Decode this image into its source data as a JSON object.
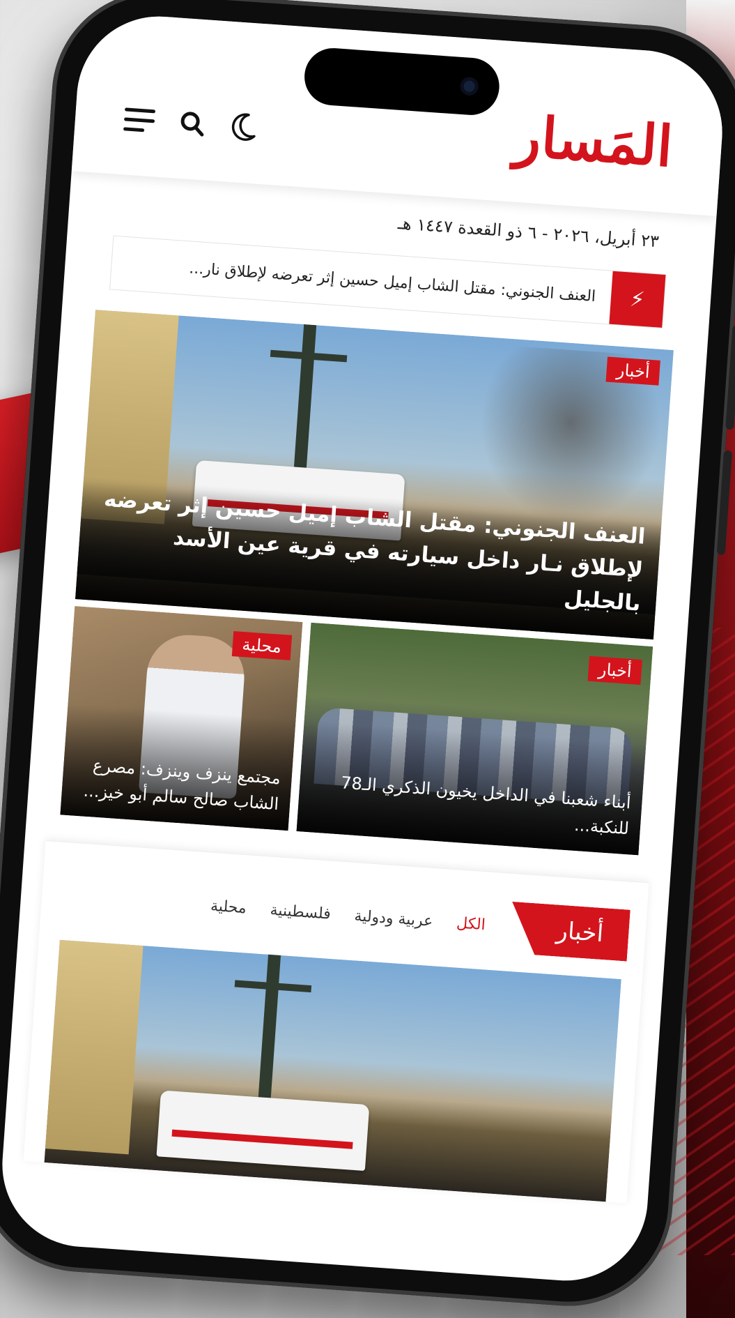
{
  "app": {
    "logo_text": "المَسار",
    "brand_color": "#d3141c",
    "date_text": "٢٣ أبريل، ٢٠٢٦ - ٦ ذو القعدة ١٤٤٧ هـ"
  },
  "header": {
    "icons": [
      "hamburger-menu-icon",
      "search-icon",
      "moon-icon"
    ]
  },
  "ticker": {
    "icon": "bolt-icon",
    "text": "العنف الجنوني: مقتل الشاب إميل حسين إثر تعرضه لإطلاق نار..."
  },
  "hero": {
    "badge": "أخبار",
    "title": "العنف الجنوني: مقتل الشاب إميل حسين إثر تعرضه لإطلاق نـار داخل سيارته في قرية عين الأسد بالجليل"
  },
  "cards": [
    {
      "badge": "أخبار",
      "title": "أبناء شعبنا في الداخل يخيون الذكري الـ78 للنكبة..."
    },
    {
      "badge": "محلية",
      "title": "مجتمع ينزف وينزف: مصرع الشاب صالح سالم أبو خيز..."
    }
  ],
  "section": {
    "title": "أخبار",
    "tabs": [
      {
        "label": "الكل",
        "active": true
      },
      {
        "label": "عربية ودولية",
        "active": false
      },
      {
        "label": "فلسطينية",
        "active": false
      },
      {
        "label": "محلية",
        "active": false
      }
    ]
  }
}
